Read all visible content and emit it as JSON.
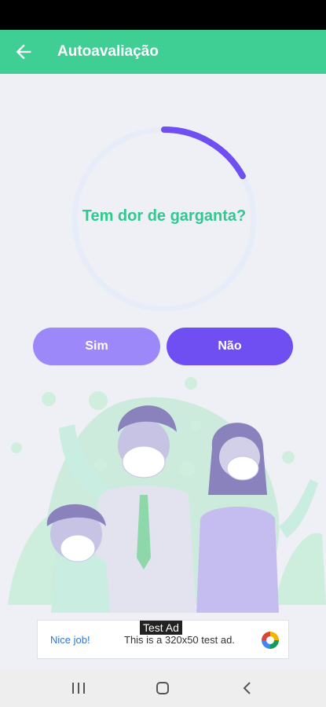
{
  "appbar": {
    "title": "Autoavaliação",
    "back_icon": "arrow-left-icon"
  },
  "quiz": {
    "question": "Tem dor de garganta?",
    "progress": 0.17
  },
  "buttons": {
    "yes": "Sim",
    "no": "Não"
  },
  "ad": {
    "badge": "Test Ad",
    "nice": "Nice job!",
    "text": "This is a 320x50 test ad."
  },
  "navbar": {
    "recent_icon": "recent-apps-icon",
    "home_icon": "home-icon",
    "back_icon": "back-icon"
  },
  "colors": {
    "accent": "#3fcf95",
    "primary": "#6f4ff2",
    "secondary": "#9d88f9"
  }
}
